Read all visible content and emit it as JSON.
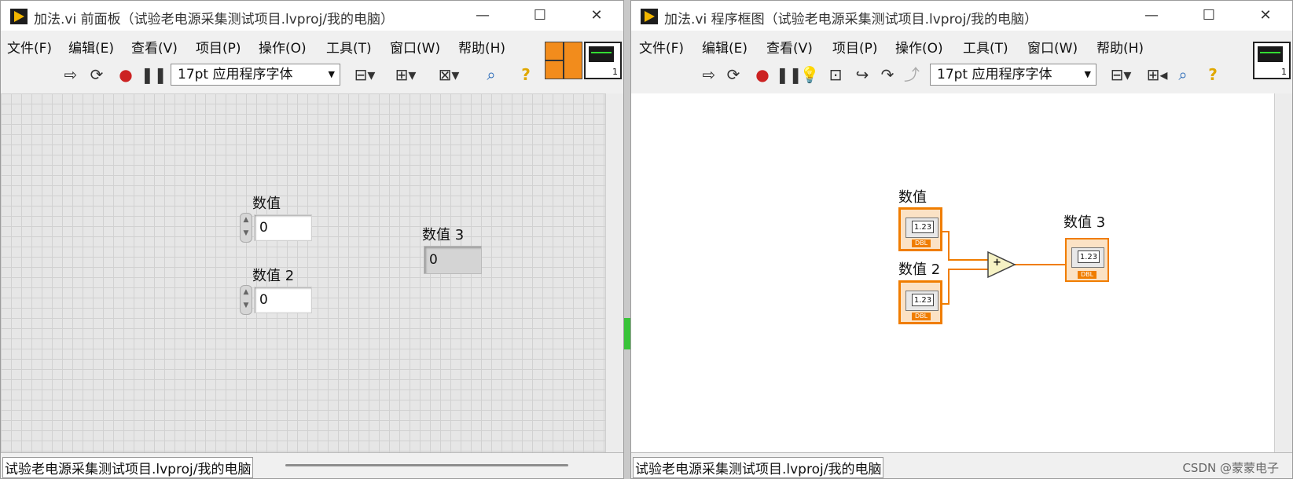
{
  "front_panel": {
    "title": "加法.vi 前面板（试验老电源采集测试项目.lvproj/我的电脑）",
    "menus": [
      "文件(F)",
      "编辑(E)",
      "查看(V)",
      "项目(P)",
      "操作(O)",
      "工具(T)",
      "窗口(W)",
      "帮助(H)"
    ],
    "font_select": "17pt 应用程序字体",
    "controls": [
      {
        "label": "数值",
        "value": "0"
      },
      {
        "label": "数值 2",
        "value": "0"
      }
    ],
    "indicator": {
      "label": "数值 3",
      "value": "0"
    },
    "status": "试验老电源采集测试项目.lvproj/我的电脑",
    "icon_number": "1"
  },
  "block_diagram": {
    "title": "加法.vi 程序框图（试验老电源采集测试项目.lvproj/我的电脑）",
    "menus": [
      "文件(F)",
      "编辑(E)",
      "查看(V)",
      "项目(P)",
      "操作(O)",
      "工具(T)",
      "窗口(W)",
      "帮助(H)"
    ],
    "font_select": "17pt 应用程序字体",
    "terminals": [
      {
        "label": "数值",
        "num": "1.23",
        "type": "DBL"
      },
      {
        "label": "数值 2",
        "num": "1.23",
        "type": "DBL"
      },
      {
        "label": "数值 3",
        "num": "1.23",
        "type": "DBL"
      }
    ],
    "add_symbol": "+",
    "status": "试验老电源采集测试项目.lvproj/我的电脑",
    "icon_number": "1"
  },
  "window_buttons": {
    "minimize": "—",
    "maximize": "☐",
    "close": "✕"
  },
  "watermark": "CSDN @蒙蒙电子"
}
